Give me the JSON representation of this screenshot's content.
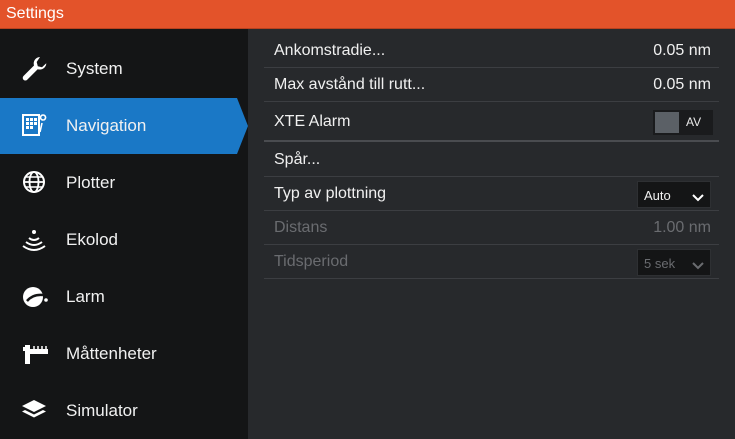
{
  "window": {
    "title": "Settings"
  },
  "sidebar": {
    "items": [
      {
        "label": "System",
        "icon": "wrench-icon"
      },
      {
        "label": "Navigation",
        "icon": "navigation-icon",
        "selected": true
      },
      {
        "label": "Plotter",
        "icon": "globe-icon"
      },
      {
        "label": "Ekolod",
        "icon": "sonar-icon"
      },
      {
        "label": "Larm",
        "icon": "alarm-icon"
      },
      {
        "label": "Måttenheter",
        "icon": "ruler-icon"
      },
      {
        "label": "Simulator",
        "icon": "layers-icon"
      }
    ]
  },
  "settings": {
    "arrival_radius": {
      "label": "Ankomstradie...",
      "value": "0.05 nm"
    },
    "max_route_distance": {
      "label": "Max avstånd till rutt...",
      "value": "0.05 nm"
    },
    "xte_alarm": {
      "label": "XTE Alarm",
      "state": "AV"
    },
    "trails": {
      "label": "Spår..."
    },
    "plotting_type": {
      "label": "Typ av plottning",
      "value": "Auto"
    },
    "distance": {
      "label": "Distans",
      "value": "1.00 nm",
      "disabled": true
    },
    "time_period": {
      "label": "Tidsperiod",
      "value": "5 sek",
      "disabled": true
    }
  },
  "colors": {
    "title_bar": "#e3532a",
    "selected": "#1a78c6",
    "sidebar_bg": "#141516",
    "panel_bg": "#27292c",
    "disabled_text": "#6a6c70"
  }
}
